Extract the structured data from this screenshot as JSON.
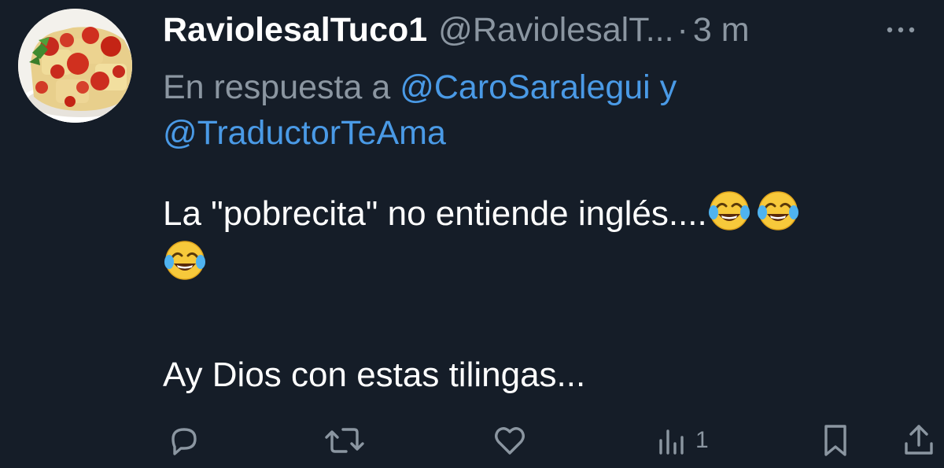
{
  "tweet": {
    "display_name": "RaviolesalTuco1",
    "handle": "@RaviolesalT...",
    "separator": "·",
    "time": "3 m",
    "reply_prefix": "En respuesta a",
    "reply_mention_1": "@CaroSaralegui",
    "reply_joiner": "y",
    "reply_mention_2": "@TraductorTeAma",
    "text_line_1": "La \"pobrecita\" no entiende inglés....",
    "text_line_2": "Ay Dios con estas tilingas..."
  },
  "actions": {
    "views_count": "1"
  },
  "icons": {
    "more": "more-horizontal-icon",
    "reply": "reply-icon",
    "retweet": "retweet-icon",
    "like": "heart-icon",
    "views": "views-chart-icon",
    "bookmark": "bookmark-icon",
    "share": "share-icon",
    "emoji": "face-with-tears-of-joy-emoji"
  },
  "colors": {
    "background": "#151d28",
    "primary_text": "#ffffff",
    "secondary_text": "#8b96a1",
    "link": "#4a9ae6"
  }
}
